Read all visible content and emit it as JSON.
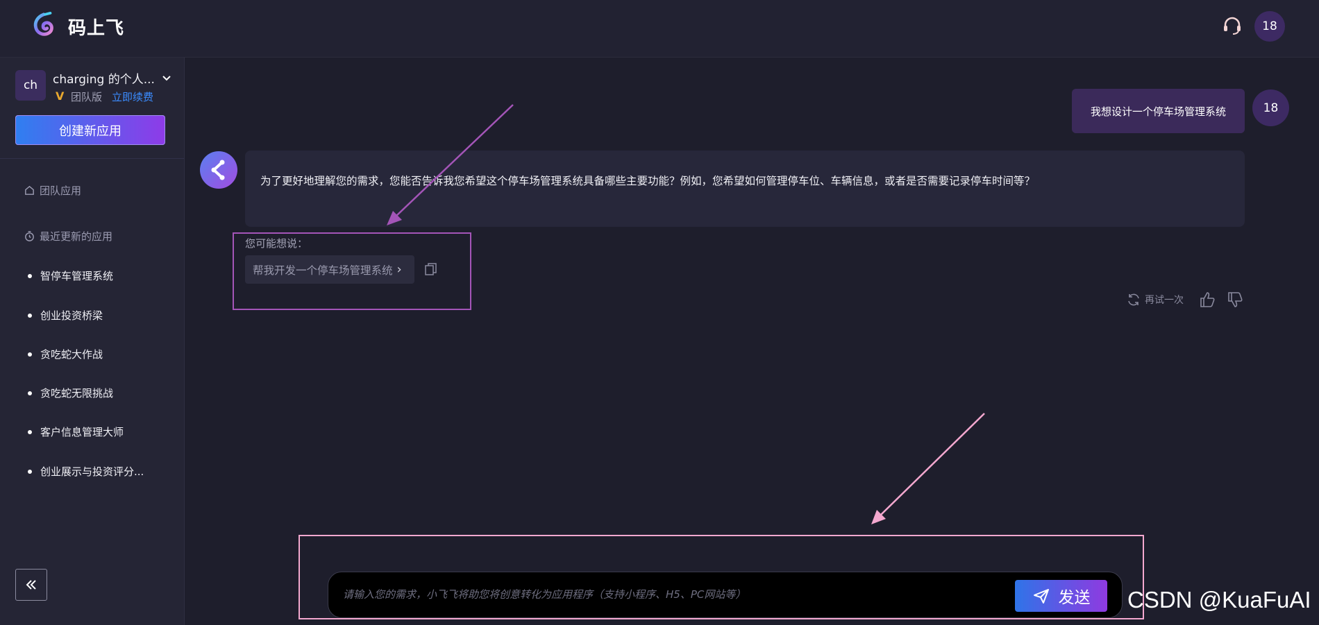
{
  "header": {
    "brand": "码上飞",
    "user_badge": "18",
    "icons": {
      "logo": "brand-logo-icon",
      "support": "headset-icon"
    }
  },
  "sidebar": {
    "workspace": {
      "avatar_text": "ch",
      "name": "charging 的个人...",
      "plan_icon": "V",
      "plan": "团队版",
      "renew_link": "立即续费"
    },
    "create_button": "创建新应用",
    "sections": [
      {
        "label": "团队应用",
        "icon": "home-icon"
      },
      {
        "label": "最近更新的应用",
        "icon": "clock-icon"
      }
    ],
    "recent_apps": [
      "智停车管理系统",
      "创业投资桥梁",
      "贪吃蛇大作战",
      "贪吃蛇无限挑战",
      "客户信息管理大师",
      "创业展示与投资评分..."
    ]
  },
  "chat": {
    "user_message": "我想设计一个停车场管理系统",
    "user_avatar": "18",
    "bot_message": "为了更好地理解您的需求，您能否告诉我您希望这个停车场管理系统具备哪些主要功能？例如，您希望如何管理停车位、车辆信息，或者是否需要记录停车时间等？",
    "suggest_label": "您可能想说：",
    "suggestion": "帮我开发一个停车场管理系统",
    "retry_label": "再试一次"
  },
  "input": {
    "placeholder": "请输入您的需求，小飞飞将助您将创意转化为应用程序（支持小程序、H5、PC网站等）",
    "send_label": "发送"
  },
  "watermark": "CSDN @KuaFuAI",
  "colors": {
    "background": "#1e1e2c",
    "sidebar": "#252535",
    "accent_start": "#2f7ff0",
    "accent_end": "#8e3be8",
    "annotation_purple": "#a455b8",
    "annotation_pink": "#f4a8cf"
  }
}
